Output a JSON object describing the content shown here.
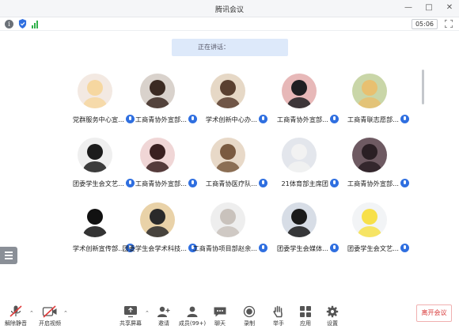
{
  "window": {
    "title": "腾讯会议"
  },
  "status": {
    "timer": "05:06"
  },
  "speaking_label": "正在讲话：",
  "participants": [
    {
      "name": "党群服务中心宣...",
      "avatar": "anime-girl-blonde",
      "bg": "#f3e9e2",
      "fg": "#f6d7a0"
    },
    {
      "name": "工商青协外宣部...",
      "avatar": "person-dark-hair",
      "bg": "#d9d2cc",
      "fg": "#3b2a22"
    },
    {
      "name": "学术创新中心办...",
      "avatar": "person-hands-up",
      "bg": "#e6d8c6",
      "fg": "#5a4030"
    },
    {
      "name": "工商青协外宣部...",
      "avatar": "person-red-flowers",
      "bg": "#e7b8b8",
      "fg": "#1f1f22"
    },
    {
      "name": "工商青联志愿部...",
      "avatar": "cat-in-cup",
      "bg": "#c9d6a8",
      "fg": "#e8c070"
    },
    {
      "name": "团委学生会文艺...",
      "avatar": "person-face-cover",
      "bg": "#efefef",
      "fg": "#1c1c1c"
    },
    {
      "name": "工商青协外宣部...",
      "avatar": "person-holding-flower",
      "bg": "#f0d6d6",
      "fg": "#3a2020"
    },
    {
      "name": "工商青协医疗队...",
      "avatar": "person-with-dog",
      "bg": "#e8d9c8",
      "fg": "#7a5a40"
    },
    {
      "name": "21体育部主席团",
      "avatar": "person-white-hair",
      "bg": "#e3e6ec",
      "fg": "#f2f2f2"
    },
    {
      "name": "工商青协外宣部...",
      "avatar": "person-dark-scene",
      "bg": "#6e5a62",
      "fg": "#2a1f24"
    },
    {
      "name": "学术创新宣传部...",
      "avatar": "cartoon-boy",
      "bg": "#ffffff",
      "fg": "#111111"
    },
    {
      "name": "团委学生会学术科技...",
      "avatar": "cat-sunglasses",
      "bg": "#e9d2a8",
      "fg": "#2a2a2a"
    },
    {
      "name": "工商青协项目部赵余...",
      "avatar": "white-cat",
      "bg": "#eeeeee",
      "fg": "#c9c2bc"
    },
    {
      "name": "团委学生会媒体...",
      "avatar": "anime-character-dark",
      "bg": "#d7dde6",
      "fg": "#1a1a1a"
    },
    {
      "name": "团委学生会文艺...",
      "avatar": "cartoon-bird-yellow",
      "bg": "#f2f4f6",
      "fg": "#f7e04a"
    }
  ],
  "toolbar": {
    "mute_label": "解除静音",
    "video_label": "开启视频",
    "share_label": "共享屏幕",
    "invite_label": "邀请",
    "members_label": "成员(99+)",
    "chat_label": "聊天",
    "record_label": "录制",
    "raise_hand_label": "举手",
    "apps_label": "应用",
    "settings_label": "设置",
    "leave_label": "离开会议"
  },
  "colors": {
    "accent": "#2f6fe0",
    "leave": "#d83a3a",
    "speaking_bg": "#dde9fa"
  }
}
